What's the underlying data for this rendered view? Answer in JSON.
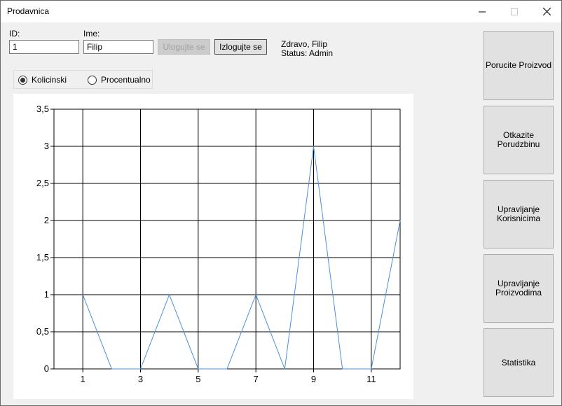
{
  "window": {
    "title": "Prodavnica",
    "minimize_icon": "minimize-icon",
    "maximize_icon": "maximize-icon",
    "close_icon": "close-icon"
  },
  "login": {
    "id_label": "ID:",
    "id_value": "1",
    "name_label": "Ime:",
    "name_value": "Filip",
    "login_button": "Ulogujte se",
    "logout_button": "Izlogujte se",
    "greeting": "Zdravo, Filip",
    "status": "Status: Admin"
  },
  "mode": {
    "option_quantity": "Kolicinski",
    "option_percent": "Procentualno",
    "selected": "Kolicinski"
  },
  "sidebar": {
    "buttons": [
      {
        "label": "Porucite Proizvod"
      },
      {
        "label": "Otkazite\nPorudzbinu"
      },
      {
        "label": "Upravljanje\nKorisnicima"
      },
      {
        "label": "Upravljanje\nProizvodima"
      },
      {
        "label": "Statistika"
      }
    ]
  },
  "chart_data": {
    "type": "line",
    "x": [
      1,
      2,
      3,
      4,
      5,
      6,
      7,
      8,
      9,
      10,
      11,
      12
    ],
    "series": [
      {
        "values": [
          1,
          0,
          0,
          1,
          0,
          0,
          1,
          0,
          3,
          0,
          0,
          2
        ],
        "color": "#4a90d9"
      }
    ],
    "xlim": [
      0,
      12
    ],
    "ylim": [
      0,
      3.5
    ],
    "x_ticks": [
      "1",
      "3",
      "5",
      "7",
      "9",
      "11"
    ],
    "y_ticks": [
      "0",
      "0,5",
      "1",
      "1,5",
      "2",
      "2,5",
      "3",
      "3,5"
    ],
    "grid": true
  }
}
